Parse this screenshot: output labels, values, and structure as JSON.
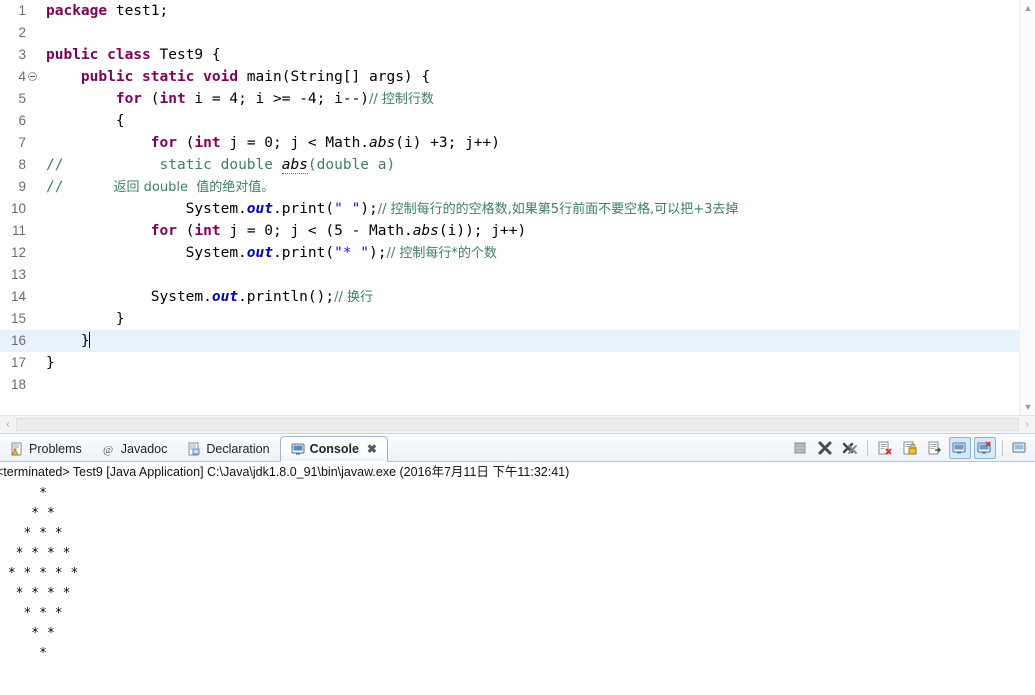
{
  "editor": {
    "language": "java",
    "current_line": 16,
    "lines": [
      {
        "num": 1,
        "fold": false,
        "tokens": [
          {
            "t": "package ",
            "c": "kw"
          },
          {
            "t": "test1;",
            "c": "plain"
          }
        ]
      },
      {
        "num": 2,
        "fold": false,
        "tokens": []
      },
      {
        "num": 3,
        "fold": false,
        "tokens": [
          {
            "t": "public class ",
            "c": "kw"
          },
          {
            "t": "Test9 {",
            "c": "plain"
          }
        ]
      },
      {
        "num": 4,
        "fold": true,
        "tokens": [
          {
            "t": "    public static void ",
            "c": "kw"
          },
          {
            "t": "main(String[] args) {",
            "c": "plain"
          }
        ]
      },
      {
        "num": 5,
        "fold": false,
        "tokens": [
          {
            "t": "        for ",
            "c": "kw"
          },
          {
            "t": "(",
            "c": "plain"
          },
          {
            "t": "int",
            "c": "kw"
          },
          {
            "t": " i = 4; i >= -4; i--)",
            "c": "plain"
          },
          {
            "t": "// 控制行数",
            "c": "cmt"
          }
        ]
      },
      {
        "num": 6,
        "fold": false,
        "tokens": [
          {
            "t": "        {",
            "c": "plain"
          }
        ]
      },
      {
        "num": 7,
        "fold": false,
        "tokens": [
          {
            "t": "            for ",
            "c": "kw"
          },
          {
            "t": "(",
            "c": "plain"
          },
          {
            "t": "int",
            "c": "kw"
          },
          {
            "t": " j = 0; j < Math.",
            "c": "plain"
          },
          {
            "t": "abs",
            "c": "mth"
          },
          {
            "t": "(i) +3; j++)",
            "c": "plain"
          }
        ]
      },
      {
        "num": 8,
        "fold": false,
        "tokens": [
          {
            "t": "// ",
            "c": "cmt"
          },
          {
            "t": "          static double ",
            "c": "cmt"
          },
          {
            "t": "abs",
            "c": "cmt-u"
          },
          {
            "t": "(double a)",
            "c": "cmt"
          }
        ]
      },
      {
        "num": 9,
        "fold": false,
        "tokens": [
          {
            "t": "// ",
            "c": "cmt"
          },
          {
            "t": "          返回 double  值的绝对值。",
            "c": "cmt"
          }
        ]
      },
      {
        "num": 10,
        "fold": false,
        "tokens": [
          {
            "t": "                System.",
            "c": "plain"
          },
          {
            "t": "out",
            "c": "fld"
          },
          {
            "t": ".print(",
            "c": "plain"
          },
          {
            "t": "\" \"",
            "c": "str"
          },
          {
            "t": ");",
            "c": "plain"
          },
          {
            "t": "// 控制每行的的空格数,如果第5行前面不要空格,可以把+3去掉",
            "c": "cmt"
          }
        ]
      },
      {
        "num": 11,
        "fold": false,
        "tokens": [
          {
            "t": "            for ",
            "c": "kw"
          },
          {
            "t": "(",
            "c": "plain"
          },
          {
            "t": "int",
            "c": "kw"
          },
          {
            "t": " j = 0; j < (5 - Math.",
            "c": "plain"
          },
          {
            "t": "abs",
            "c": "mth"
          },
          {
            "t": "(i)); j++)",
            "c": "plain"
          }
        ]
      },
      {
        "num": 12,
        "fold": false,
        "tokens": [
          {
            "t": "                System.",
            "c": "plain"
          },
          {
            "t": "out",
            "c": "fld"
          },
          {
            "t": ".print(",
            "c": "plain"
          },
          {
            "t": "\"* \"",
            "c": "str"
          },
          {
            "t": ");",
            "c": "plain"
          },
          {
            "t": "// 控制每行*的个数",
            "c": "cmt"
          }
        ]
      },
      {
        "num": 13,
        "fold": false,
        "tokens": []
      },
      {
        "num": 14,
        "fold": false,
        "tokens": [
          {
            "t": "            System.",
            "c": "plain"
          },
          {
            "t": "out",
            "c": "fld"
          },
          {
            "t": ".println();",
            "c": "plain"
          },
          {
            "t": "// 换行",
            "c": "cmt"
          }
        ]
      },
      {
        "num": 15,
        "fold": false,
        "tokens": [
          {
            "t": "        }",
            "c": "plain"
          }
        ]
      },
      {
        "num": 16,
        "fold": false,
        "tokens": [
          {
            "t": "    }",
            "c": "plain"
          }
        ],
        "caret": true
      },
      {
        "num": 17,
        "fold": false,
        "tokens": [
          {
            "t": "}",
            "c": "plain"
          }
        ]
      },
      {
        "num": 18,
        "fold": false,
        "tokens": []
      }
    ],
    "scroll": {
      "up_arrow": "▲",
      "down_arrow": "▼",
      "left_arrow": "‹",
      "right_arrow": "›"
    }
  },
  "bottom": {
    "tabs": [
      {
        "label": "Problems",
        "icon": "problems-icon",
        "active": false,
        "closeable": false
      },
      {
        "label": "Javadoc",
        "icon": "javadoc-icon",
        "active": false,
        "closeable": false
      },
      {
        "label": "Declaration",
        "icon": "declaration-icon",
        "active": false,
        "closeable": false
      },
      {
        "label": "Console",
        "icon": "console-icon",
        "active": true,
        "closeable": true
      }
    ],
    "close_glyph": "✖",
    "toolbar": [
      {
        "name": "terminate-button",
        "kind": "stop",
        "toggled": false
      },
      {
        "name": "remove-launch-button",
        "kind": "x",
        "toggled": false
      },
      {
        "name": "remove-all-terminated-button",
        "kind": "xx",
        "toggled": false
      },
      {
        "name": "separator-1",
        "kind": "sep",
        "toggled": false
      },
      {
        "name": "clear-console-button",
        "kind": "clear",
        "toggled": false
      },
      {
        "name": "scroll-lock-button",
        "kind": "lock",
        "toggled": false
      },
      {
        "name": "word-wrap-button",
        "kind": "wrap",
        "toggled": false
      },
      {
        "name": "pin-console-button",
        "kind": "pin",
        "toggled": true
      },
      {
        "name": "display-selected-console-button",
        "kind": "display",
        "toggled": true
      },
      {
        "name": "separator-2",
        "kind": "sep",
        "toggled": false
      },
      {
        "name": "open-console-button",
        "kind": "open",
        "toggled": false
      }
    ],
    "status": {
      "prefix": "<",
      "text": "terminated> Test9 [Java Application] C:\\Java\\jdk1.8.0_91\\bin\\javaw.exe (2016年7月11日 下午11:32:41)"
    },
    "console_output": [
      "     *",
      "    * *",
      "   * * *",
      "  * * * *",
      " * * * * *",
      "  * * * *",
      "   * * *",
      "    * *",
      "     *"
    ]
  },
  "colors": {
    "keyword": "#7f0055",
    "string": "#2a00ff",
    "comment": "#3f7f5f",
    "field": "#0000c0",
    "current_line": "#e8f2fc",
    "tab_active_bg": "#ffffff",
    "toolbar_toggle": "#d6e7f8"
  }
}
